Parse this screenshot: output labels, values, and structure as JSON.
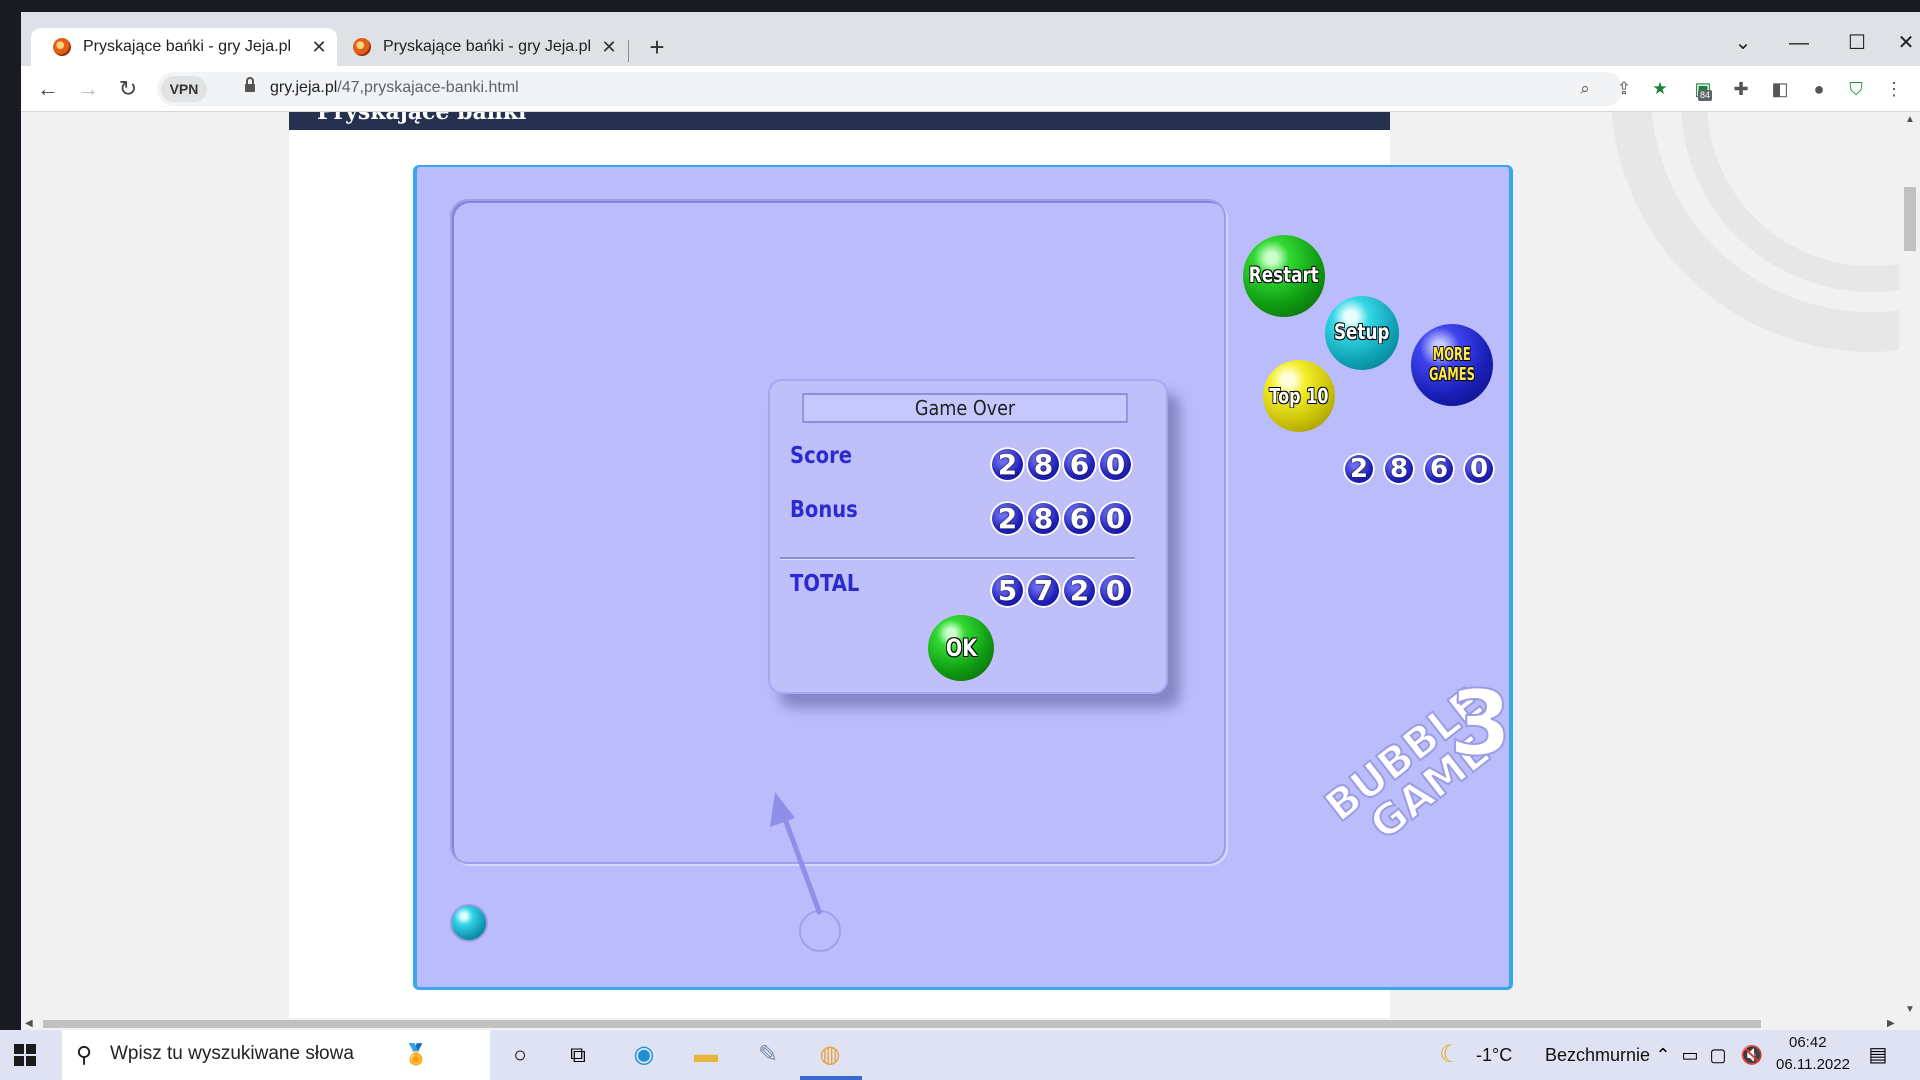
{
  "browser": {
    "tabs": [
      {
        "title": "Pryskające bańki - gry Jeja.pl",
        "close": "✕"
      },
      {
        "title": "Pryskające bańki - gry Jeja.pl",
        "close": "✕"
      }
    ],
    "new_tab": "+",
    "window_controls": {
      "tab_search": "⌄",
      "minimize": "—",
      "maximize": "☐",
      "close": "✕"
    },
    "nav": {
      "back": "←",
      "forward": "→",
      "reload": "↻"
    },
    "vpn_label": "VPN",
    "url_host": "gry.jeja.pl",
    "url_path": "/47,pryskajace-banki.html",
    "extension_badge": "84"
  },
  "page": {
    "header_title": "Pryskające bańki"
  },
  "game": {
    "buttons": {
      "restart": "Restart",
      "setup": "Setup",
      "more_games_line1": "MORE",
      "more_games_line2": "GAMES",
      "top10": "Top 10",
      "ok": "OK"
    },
    "side_score_digits": [
      "2",
      "8",
      "6",
      "0"
    ],
    "dialog": {
      "title": "Game Over",
      "score_label": "Score",
      "score_digits": [
        "2",
        "8",
        "6",
        "0"
      ],
      "bonus_label": "Bonus",
      "bonus_digits": [
        "2",
        "8",
        "6",
        "0"
      ],
      "total_label": "TOTAL",
      "total_digits": [
        "5",
        "7",
        "2",
        "0"
      ]
    },
    "logo_line1": "BUBBLE",
    "logo_line2": "GAME",
    "logo_number": "3"
  },
  "taskbar": {
    "search_placeholder": "Wpisz tu wyszukiwane słowa",
    "weather_temp": "-1°C",
    "weather_desc": "Bezchmurnie",
    "time": "06:42",
    "date": "06.11.2022"
  },
  "colors": {
    "game_bg": "#bbbcfb",
    "game_border": "#39a7f0",
    "header_bar": "#26304f",
    "digit_blue": "#1f20b8",
    "label_blue": "#2a2ad0"
  }
}
